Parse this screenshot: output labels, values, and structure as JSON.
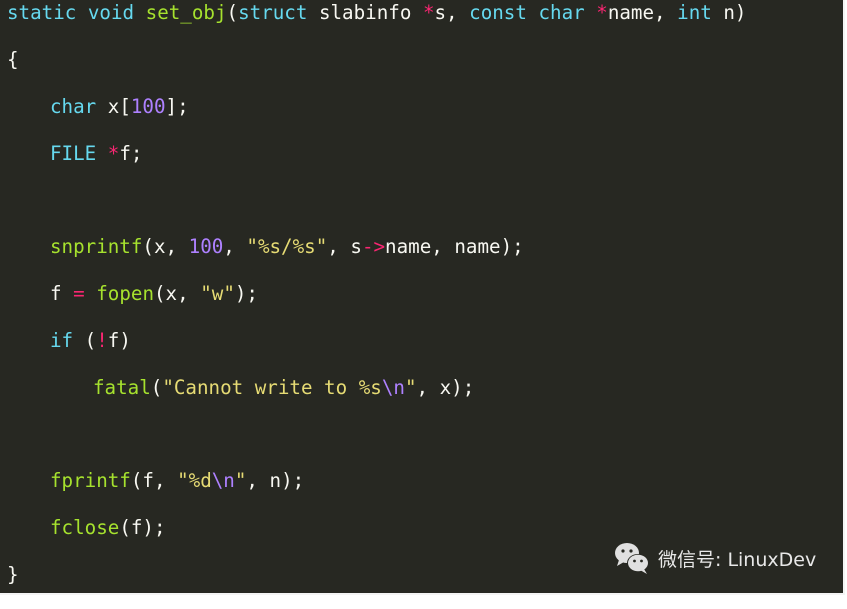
{
  "code": {
    "language": "c",
    "lines": [
      [
        {
          "t": "kw",
          "v": "static"
        },
        {
          "t": "p",
          "v": " "
        },
        {
          "t": "kw",
          "v": "void"
        },
        {
          "t": "p",
          "v": " "
        },
        {
          "t": "fn",
          "v": "set_obj"
        },
        {
          "t": "p",
          "v": "("
        },
        {
          "t": "kw",
          "v": "struct"
        },
        {
          "t": "p",
          "v": " slabinfo "
        },
        {
          "t": "op",
          "v": "*"
        },
        {
          "t": "p",
          "v": "s, "
        },
        {
          "t": "kw",
          "v": "const"
        },
        {
          "t": "p",
          "v": " "
        },
        {
          "t": "kw",
          "v": "char"
        },
        {
          "t": "p",
          "v": " "
        },
        {
          "t": "op",
          "v": "*"
        },
        {
          "t": "p",
          "v": "name, "
        },
        {
          "t": "kw",
          "v": "int"
        },
        {
          "t": "p",
          "v": " n)"
        }
      ],
      [
        {
          "t": "p",
          "v": "{"
        }
      ],
      [
        {
          "t": "kw",
          "v": "char"
        },
        {
          "t": "p",
          "v": " x["
        },
        {
          "t": "num",
          "v": "100"
        },
        {
          "t": "p",
          "v": "];"
        }
      ],
      [
        {
          "t": "kw",
          "v": "FILE"
        },
        {
          "t": "p",
          "v": " "
        },
        {
          "t": "op",
          "v": "*"
        },
        {
          "t": "p",
          "v": "f;"
        }
      ],
      [],
      [
        {
          "t": "fn",
          "v": "snprintf"
        },
        {
          "t": "p",
          "v": "(x, "
        },
        {
          "t": "num",
          "v": "100"
        },
        {
          "t": "p",
          "v": ", "
        },
        {
          "t": "str",
          "v": "\"%s/%s\""
        },
        {
          "t": "p",
          "v": ", s"
        },
        {
          "t": "op",
          "v": "->"
        },
        {
          "t": "p",
          "v": "name, name);"
        }
      ],
      [
        {
          "t": "p",
          "v": "f "
        },
        {
          "t": "op",
          "v": "="
        },
        {
          "t": "p",
          "v": " "
        },
        {
          "t": "fn",
          "v": "fopen"
        },
        {
          "t": "p",
          "v": "(x, "
        },
        {
          "t": "str",
          "v": "\"w\""
        },
        {
          "t": "p",
          "v": ");"
        }
      ],
      [
        {
          "t": "kw",
          "v": "if"
        },
        {
          "t": "p",
          "v": " ("
        },
        {
          "t": "op",
          "v": "!"
        },
        {
          "t": "p",
          "v": "f)"
        }
      ],
      [
        {
          "t": "fn",
          "v": "fatal"
        },
        {
          "t": "p",
          "v": "("
        },
        {
          "t": "str",
          "v": "\"Cannot write to %s"
        },
        {
          "t": "esc",
          "v": "\\n"
        },
        {
          "t": "str",
          "v": "\""
        },
        {
          "t": "p",
          "v": ", x);"
        }
      ],
      [],
      [
        {
          "t": "fn",
          "v": "fprintf"
        },
        {
          "t": "p",
          "v": "(f, "
        },
        {
          "t": "str",
          "v": "\"%d"
        },
        {
          "t": "esc",
          "v": "\\n"
        },
        {
          "t": "str",
          "v": "\""
        },
        {
          "t": "p",
          "v": ", n);"
        }
      ],
      [
        {
          "t": "fn",
          "v": "fclose"
        },
        {
          "t": "p",
          "v": "(f);"
        }
      ],
      [
        {
          "t": "p",
          "v": "}"
        }
      ]
    ],
    "indent": [
      0,
      0,
      1,
      1,
      0,
      1,
      1,
      1,
      2,
      0,
      1,
      1,
      0
    ]
  },
  "watermark": {
    "icon": "wechat-icon",
    "text": "微信号: LinuxDev"
  },
  "colors": {
    "background": "#272822",
    "keyword": "#66d9ef",
    "function": "#a6e22e",
    "operator": "#f92672",
    "number": "#ae81ff",
    "string": "#e6db74",
    "plain": "#f8f8f2"
  }
}
